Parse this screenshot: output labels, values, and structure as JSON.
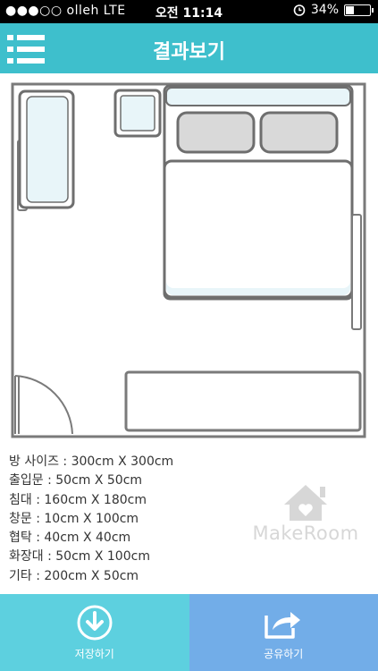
{
  "status": {
    "carrier": "●●●○○ olleh  LTE",
    "time": "오전 11:14",
    "battery": "34%",
    "battery_level": 0.34
  },
  "header": {
    "title": "결과보기",
    "menu_icon": "hamburger-list-icon"
  },
  "info": {
    "lines": [
      "방 사이즈 : 300cm X 300cm",
      "출입문 : 50cm X 50cm",
      "침대 : 160cm X 180cm",
      "창문 : 10cm X 100cm",
      "협탁 : 40cm X 40cm",
      "화장대 : 50cm X 100cm",
      "기타 : 200cm X 50cm"
    ]
  },
  "logo": {
    "text": "MakeRoom",
    "icon": "house-heart-icon"
  },
  "bottom": {
    "save_label": "저장하기",
    "share_label": "공유하기",
    "save_icon": "download-circle-icon",
    "share_icon": "share-box-icon"
  },
  "colors": {
    "header": "#3ebfcc",
    "save": "#5dd0df",
    "share": "#72ade8",
    "furniture_outline": "#6e6e6e",
    "furniture_fill": "#e8f5f9"
  }
}
